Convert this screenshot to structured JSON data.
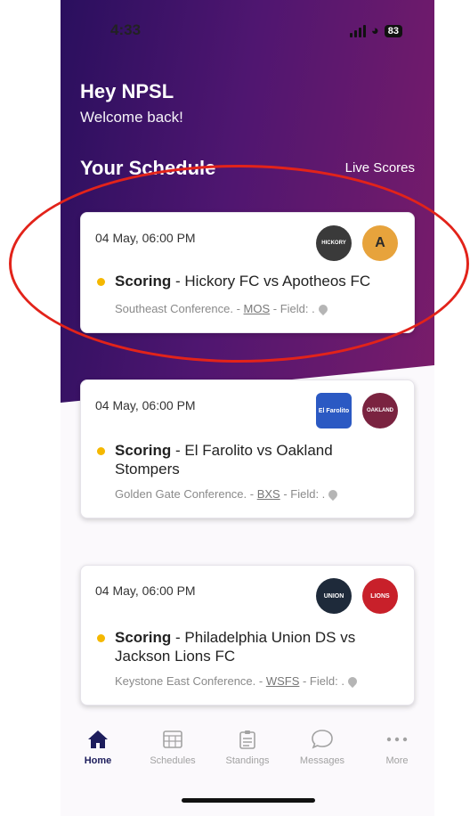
{
  "status": {
    "time": "4:33",
    "battery": "83"
  },
  "greeting": {
    "title": "Hey NPSL",
    "subtitle": "Welcome back!"
  },
  "schedule": {
    "title": "Your Schedule",
    "live_scores": "Live Scores"
  },
  "cards": [
    {
      "date": "04 May, 06:00 PM",
      "status": "Scoring",
      "teams": " - Hickory FC vs Apotheos FC",
      "conference": "Southeast Conference. - ",
      "venue": "MOS",
      "field": " - Field: .",
      "logo1": "HICKORY",
      "logo2": "A"
    },
    {
      "date": "04 May, 06:00 PM",
      "status": "Scoring",
      "teams": " - El Farolito vs Oakland Stompers",
      "conference": "Golden Gate Conference. - ",
      "venue": "BXS",
      "field": " - Field: .",
      "logo1": "El Farolito",
      "logo2": "OAKLAND"
    },
    {
      "date": "04 May, 06:00 PM",
      "status": "Scoring",
      "teams": " - Philadelphia Union DS vs Jackson Lions FC",
      "conference": "Keystone East Conference. - ",
      "venue": "WSFS",
      "field": " - Field: .",
      "logo1": "UNION",
      "logo2": "LIONS"
    }
  ],
  "tabs": [
    "Home",
    "Schedules",
    "Standings",
    "Messages",
    "More"
  ],
  "colors": {
    "accent": "#1d1d5c",
    "status_dot": "#f5b800",
    "annotation": "#e2231a"
  }
}
